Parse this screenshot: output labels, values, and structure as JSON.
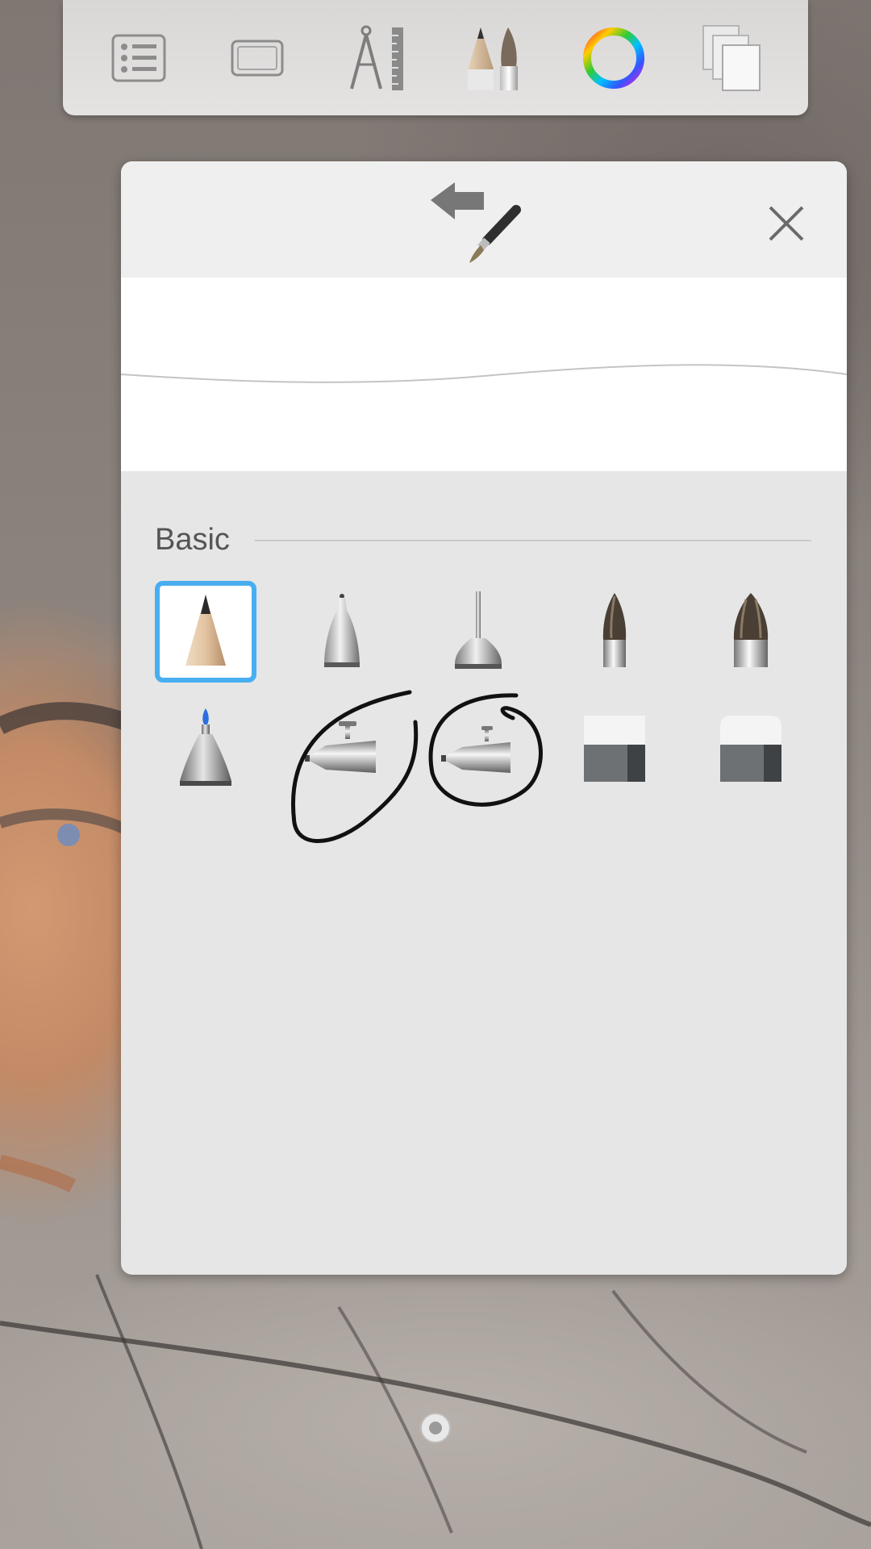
{
  "toolbar": {
    "items": [
      {
        "icon": "list-icon"
      },
      {
        "icon": "canvas-frame-icon"
      },
      {
        "icon": "compass-ruler-icon"
      },
      {
        "icon": "pencil-brush-icon"
      },
      {
        "icon": "color-wheel-icon"
      },
      {
        "icon": "layers-icon"
      }
    ]
  },
  "brush_panel": {
    "back_icon": "back-brush-icon",
    "close_icon": "close-icon",
    "section_title": "Basic",
    "selected_index": 0,
    "brushes": [
      {
        "name": "pencil"
      },
      {
        "name": "ballpoint-pen"
      },
      {
        "name": "technical-pen"
      },
      {
        "name": "paintbrush"
      },
      {
        "name": "wide-paintbrush"
      },
      {
        "name": "marker"
      },
      {
        "name": "airbrush"
      },
      {
        "name": "airbrush-small"
      },
      {
        "name": "hard-eraser"
      },
      {
        "name": "soft-eraser"
      }
    ]
  },
  "colors": {
    "selection": "#48aef0",
    "panel": "#e6e6e6",
    "header": "#efefef",
    "toolbar": "#e0dfde"
  }
}
